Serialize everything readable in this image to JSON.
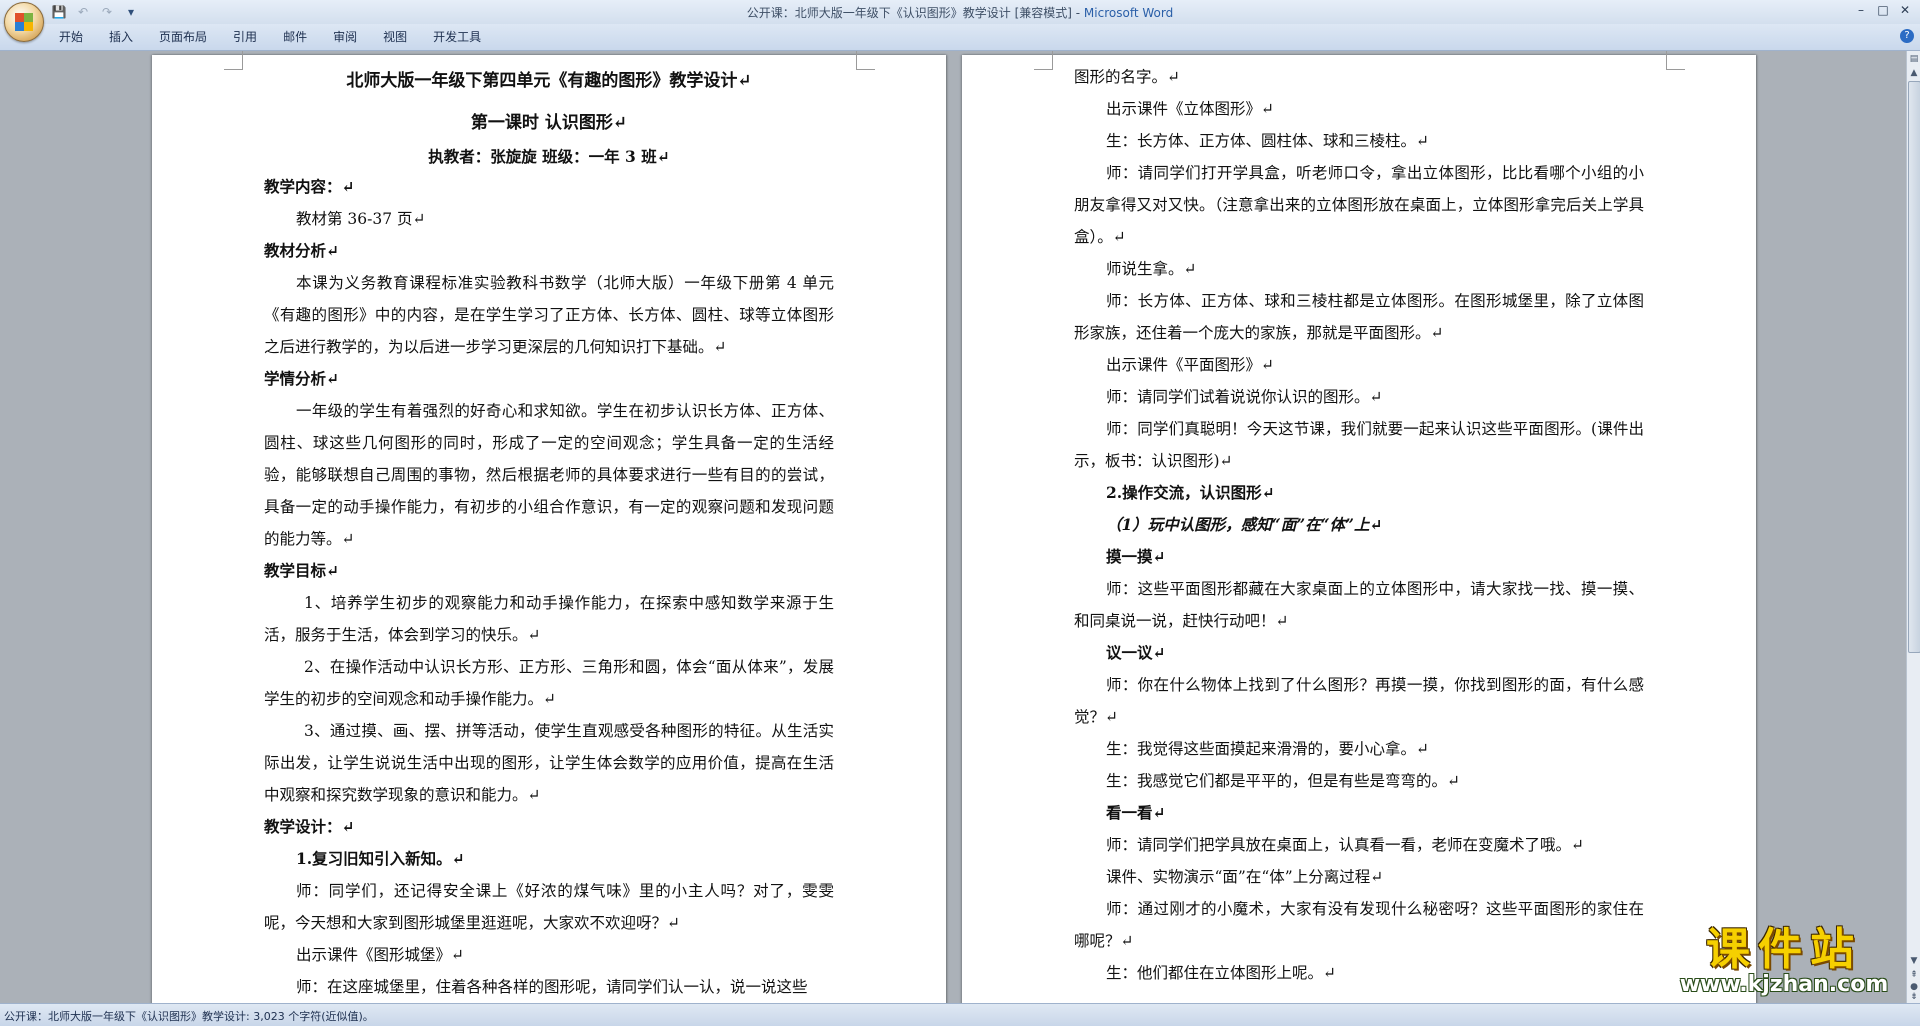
{
  "titlebar": {
    "doc_title": "公开课：北师大版一年级下《认识图形》教学设计 [兼容模式] - ",
    "app_name": "Microsoft Word",
    "qat": {
      "save_icon": "💾",
      "undo_icon": "↶",
      "redo_icon": "↷",
      "customize_icon": "▾"
    },
    "controls": {
      "minimize": "–",
      "restore": "□",
      "close": "✕"
    }
  },
  "ribbon": {
    "tabs": [
      "开始",
      "插入",
      "页面布局",
      "引用",
      "邮件",
      "审阅",
      "视图",
      "开发工具"
    ],
    "help_icon": "?"
  },
  "page1": {
    "paragraphs": [
      "北师大版一年级下第四单元《有趣的图形》教学设计↵",
      "第一课时  认识图形↵",
      "执教者：张旋旋        班级：一年 3 班↵",
      "教学内容：↵",
      "教材第 36-37 页↵",
      "教材分析↵",
      "本课为义务教育课程标准实验教科书数学（北师大版）一年级下册第 4 单元《有趣的图形》中的内容，是在学生学习了正方体、长方体、圆柱、球等立体图形之后进行教学的，为以后进一步学习更深层的几何知识打下基础。↵",
      "学情分析↵",
      "一年级的学生有着强烈的好奇心和求知欲。学生在初步认识长方体、正方体、圆柱、球这些几何图形的同时，形成了一定的空间观念；学生具备一定的生活经验，能够联想自己周围的事物，然后根据老师的具体要求进行一些有目的的尝试，具备一定的动手操作能力，有初步的小组合作意识，有一定的观察问题和发现问题的能力等。↵",
      "教学目标↵",
      "1、培养学生初步的观察能力和动手操作能力，在探索中感知数学来源于生活，服务于生活，体会到学习的快乐。↵",
      "2、在操作活动中认识长方形、正方形、三角形和圆，体会“面从体来”，发展学生的初步的空间观念和动手操作能力。↵",
      "3、通过摸、画、摆、拼等活动，使学生直观感受各种图形的特征。从生活实际出发，让学生说说生活中出现的图形，让学生体会数学的应用价值，提高在生活中观察和探究数学现象的意识和能力。↵",
      "教学设计：↵",
      "1.复习旧知引入新知。↵",
      "师：同学们，还记得安全课上《好浓的煤气味》里的小主人吗？对了，雯雯呢，今天想和大家到图形城堡里逛逛呢，大家欢不欢迎呀？↵",
      "出示课件《图形城堡》↵",
      "师：在这座城堡里，住着各种各样的图形呢，请同学们认一认，说一说这些"
    ]
  },
  "page2": {
    "paragraphs": [
      "图形的名字。↵",
      "出示课件《立体图形》↵",
      "生：长方体、正方体、圆柱体、球和三棱柱。↵",
      "师：请同学们打开学具盒，听老师口令，拿出立体图形，比比看哪个小组的小朋友拿得又对又快。（注意拿出来的立体图形放在桌面上，立体图形拿完后关上学具盒）。↵",
      "师说生拿。↵",
      "师：长方体、正方体、球和三棱柱都是立体图形。在图形城堡里，除了立体图形家族，还住着一个庞大的家族，那就是平面图形。↵",
      "出示课件《平面图形》↵",
      "师：请同学们试着说说你认识的图形。↵",
      "师：同学们真聪明！今天这节课，我们就要一起来认识这些平面图形。(课件出示，板书：认识图形)↵",
      "2.操作交流，认识图形↵",
      "（1）玩中认图形，感知“面”在“体”上↵",
      "摸一摸↵",
      "师：这些平面图形都藏在大家桌面上的立体图形中，请大家找一找、摸一摸、和同桌说一说，赶快行动吧！↵",
      "议一议↵",
      "师：你在什么物体上找到了什么图形？再摸一摸，你找到图形的面，有什么感觉？↵",
      "生：我觉得这些面摸起来滑滑的，要小心拿。↵",
      "生：我感觉它们都是平平的，但是有些是弯弯的。↵",
      "看一看↵",
      "师：请同学们把学具放在桌面上，认真看一看，老师在变魔术了哦。↵",
      "课件、实物演示“面”在“体”上分离过程↵",
      "师：通过刚才的小魔术，大家有没有发现什么秘密呀？这些平面图形的家住在哪呢？↵",
      "生：他们都住在立体图形上呢。↵"
    ]
  },
  "statusbar": {
    "text": "公开课：北师大版一年级下《认识图形》教学设计: 3,023 个字符(近似值)。"
  },
  "watermark": {
    "title": "课件站",
    "url": "www.kjzhan.com"
  }
}
